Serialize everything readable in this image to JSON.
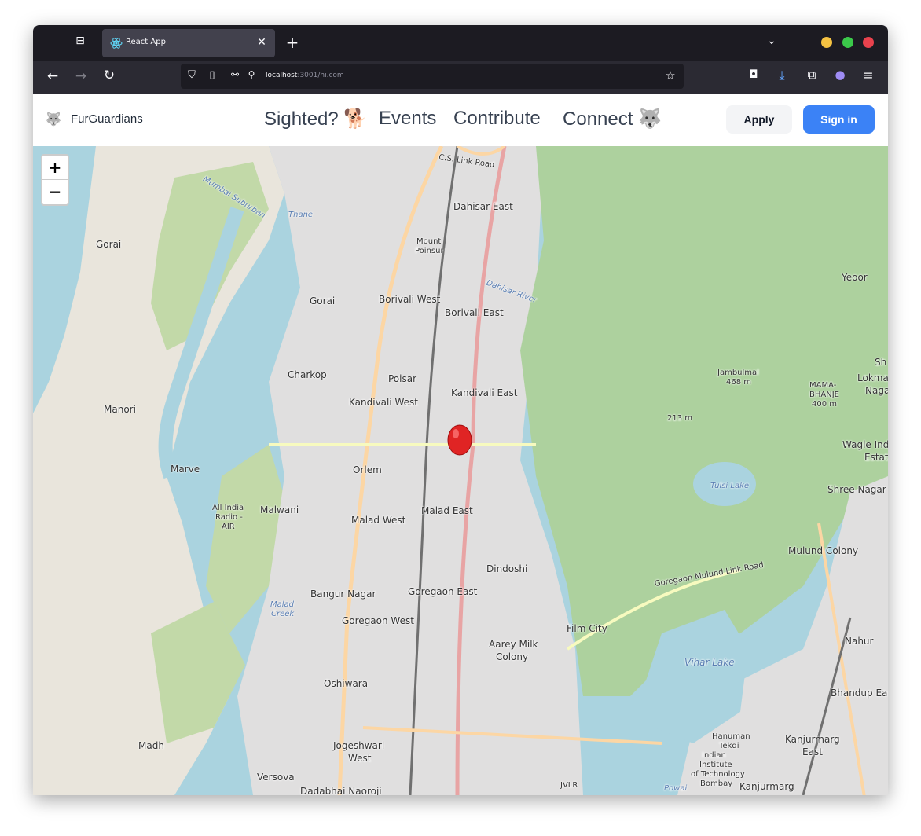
{
  "browser": {
    "tab_title": "React App",
    "url_host": "localhost",
    "url_rest": ":3001/hi.com"
  },
  "nav": {
    "brand": "FurGuardians",
    "brand_emoji": "🐺",
    "links": [
      {
        "label": "Sighted? 🐕"
      },
      {
        "label": "Events"
      },
      {
        "label": "Contribute"
      },
      {
        "label": "Connect 🐺"
      }
    ],
    "apply_label": "Apply",
    "signin_label": "Sign in"
  },
  "map": {
    "zoom_in": "+",
    "zoom_out": "−",
    "labels": {
      "gorai_w": "Gorai",
      "gorai": "Gorai",
      "manori": "Manori",
      "marve": "Marve",
      "charkop": "Charkop",
      "dahisar_east": "Dahisar East",
      "mount_poinsur_1": "Mount",
      "mount_poinsur_2": "Poinsur",
      "borivali_west": "Borivali West",
      "borivali_east": "Borivali East",
      "poisar": "Poisar",
      "kandivali_east": "Kandivali East",
      "kandivali_west": "Kandivali West",
      "orlem": "Orlem",
      "malwani": "Malwani",
      "malad_west": "Malad West",
      "malad_east": "Malad East",
      "dindoshi": "Dindoshi",
      "bangur_nagar": "Bangur Nagar",
      "goregaon_east": "Goregaon East",
      "goregaon_west": "Goregaon West",
      "film_city": "Film City",
      "aarey_1": "Aarey Milk",
      "aarey_2": "Colony",
      "oshiwara": "Oshiwara",
      "madh": "Madh",
      "jogeshwari_1": "Jogeshwari",
      "jogeshwari_2": "West",
      "versova": "Versova",
      "dadabhai": "Dadabhai Naoroji",
      "yeoor": "Yeoor",
      "jambulmal_1": "Jambulmal",
      "jambulmal_2": "468 m",
      "mama_1": "MAMA-",
      "mama_2": "BHANJE",
      "mama_3": "400 m",
      "peak_213": "213 m",
      "tulsi": "Tulsi Lake",
      "vihar": "Vihar Lake",
      "shree_nagar": "Shree Nagar",
      "mulund": "Mulund Colony",
      "wagle_1": "Wagle Ind",
      "wagle_2": "Estat",
      "lokma_1": "Lokma",
      "lokma_2": "Naga",
      "sh": "Sh",
      "nahur": "Nahur",
      "bhandup": "Bhandup Eas",
      "kanjurmarg_1": "Kanjurmarg",
      "kanjurmarg_2": "East",
      "kanjurmarg": "Kanjurmarg",
      "hanuman_1": "Hanuman",
      "hanuman_2": "Tekdi",
      "iit_1": "Indian",
      "iit_2": "Institute",
      "iit_3": "of Technology",
      "iit_4": "Bombay",
      "powai": "Powai",
      "jvlr": "JVLR",
      "air_1": "All India",
      "air_2": "Radio -",
      "air_3": "AIR",
      "malad_creek_1": "Malad",
      "malad_creek_2": "Creek",
      "thane": "Thane",
      "mumbai_suburban": "Mumbai Suburban",
      "dahisar_river": "Dahisar River",
      "cs_link": "C.S. Link Road",
      "goregaon_mulund": "Goregaon Mulund Link Road"
    }
  },
  "colors": {
    "forest": "#add19e",
    "water": "#aad3df",
    "urban": "#e0dfdf",
    "road_yellow": "#f7fabf",
    "road_orange": "#fcd6a4",
    "rail": "#707070",
    "marker": "#e02424",
    "primary": "#3b82f6"
  }
}
